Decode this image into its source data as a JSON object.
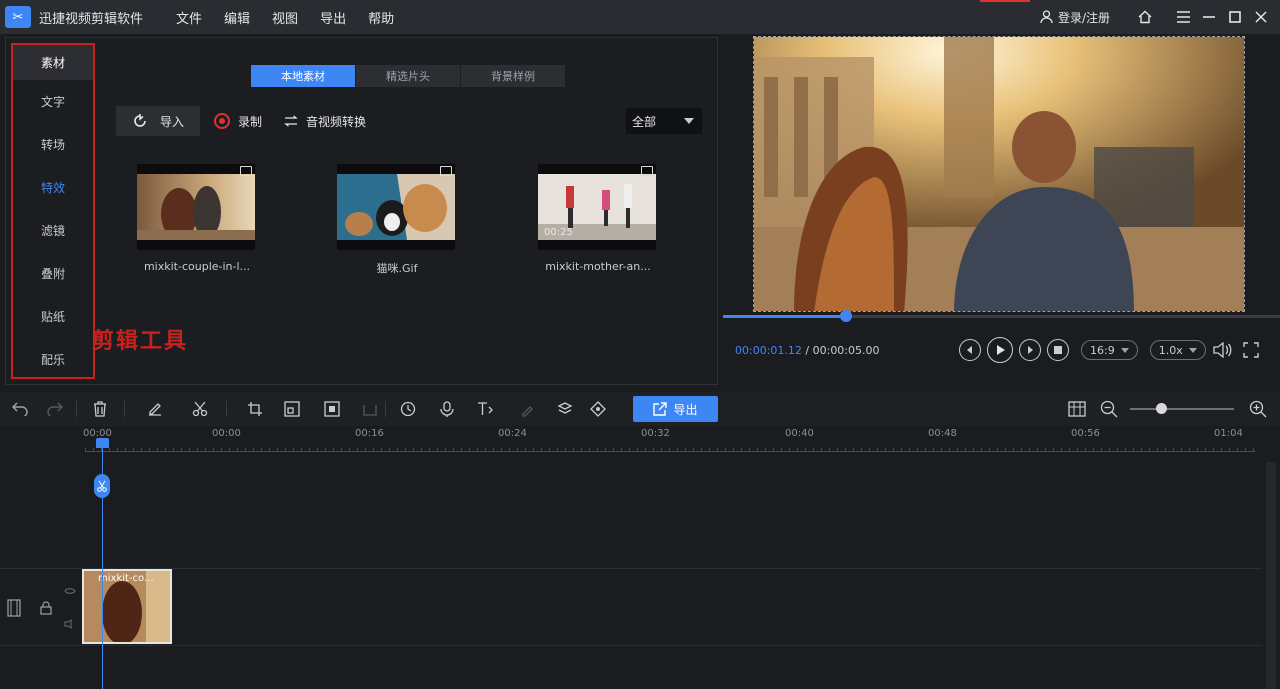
{
  "app": {
    "title": "迅捷视频剪辑软件",
    "menu": [
      "文件",
      "编辑",
      "视图",
      "导出",
      "帮助"
    ],
    "login_label": "登录/注册"
  },
  "tool_sidebar": {
    "items": [
      {
        "label": "素材",
        "state": "active"
      },
      {
        "label": "文字",
        "state": ""
      },
      {
        "label": "转场",
        "state": ""
      },
      {
        "label": "特效",
        "state": "selected"
      },
      {
        "label": "滤镜",
        "state": ""
      },
      {
        "label": "叠附",
        "state": ""
      },
      {
        "label": "贴纸",
        "state": ""
      },
      {
        "label": "配乐",
        "state": ""
      }
    ],
    "annotation": "剪辑工具"
  },
  "source_tabs": [
    "本地素材",
    "精选片头",
    "背景样例"
  ],
  "actions": {
    "import_label": "导入",
    "record_label": "录制",
    "convert_label": "音视频转换",
    "filter_value": "全部"
  },
  "media": [
    {
      "name": "mixkit-couple-in-l...",
      "time": ""
    },
    {
      "name": "猫咪.Gif",
      "time": ""
    },
    {
      "name": "mixkit-mother-an...",
      "time": "00:25"
    }
  ],
  "preview": {
    "current_time": "00:00:01.12",
    "separator": " / ",
    "total_time": "00:00:05.00",
    "progress": 0.22,
    "aspect": "16:9",
    "speed": "1.0x"
  },
  "toolbar": {
    "export_label": "导出",
    "zoom": 0.3
  },
  "ruler": [
    "00:00",
    "00:00",
    "00:16",
    "00:24",
    "00:32",
    "00:40",
    "00:48",
    "00:56",
    "01:04"
  ],
  "timeline": {
    "clip_label": "mixkit-co..."
  },
  "colors": {
    "accent": "#3f86f5",
    "highlight_border": "#c8211e"
  }
}
